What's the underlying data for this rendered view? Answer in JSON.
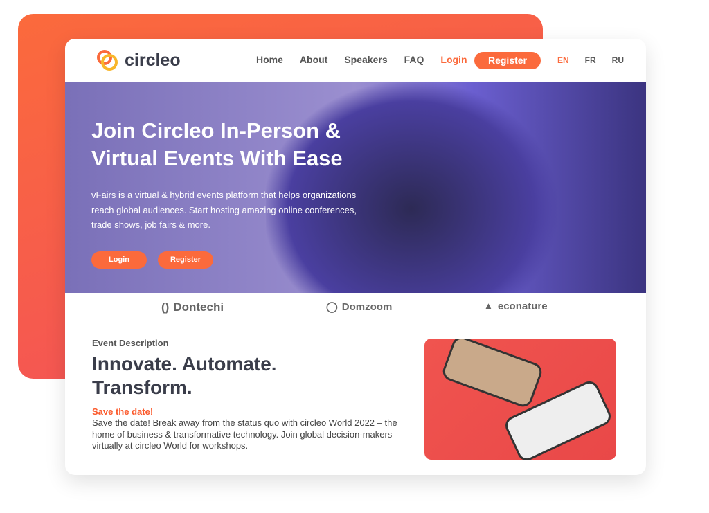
{
  "brand": {
    "name": "circleo"
  },
  "nav": {
    "items": [
      "Home",
      "About",
      "Speakers",
      "FAQ",
      "Login"
    ],
    "register": "Register",
    "langs": [
      "EN",
      "FR",
      "RU"
    ]
  },
  "hero": {
    "title": "Join Circleo In-Person & Virtual Events With Ease",
    "text": "vFairs is a virtual & hybrid events platform that helps organizations reach global audiences. Start hosting amazing online conferences, trade shows, job fairs & more.",
    "login": "Login",
    "register": "Register"
  },
  "partners": [
    "Dontechi",
    "Domzoom",
    "econature"
  ],
  "event": {
    "label": "Event Description",
    "heading": "Innovate. Automate. Transform.",
    "subhead": "Save the date!",
    "text": "Save the date! Break away from the status quo with circleo World 2022 – the home of business & transformative technology. Join global decision-makers virtually at circleo World for workshops."
  },
  "colors": {
    "accent": "#fb6a3c"
  }
}
